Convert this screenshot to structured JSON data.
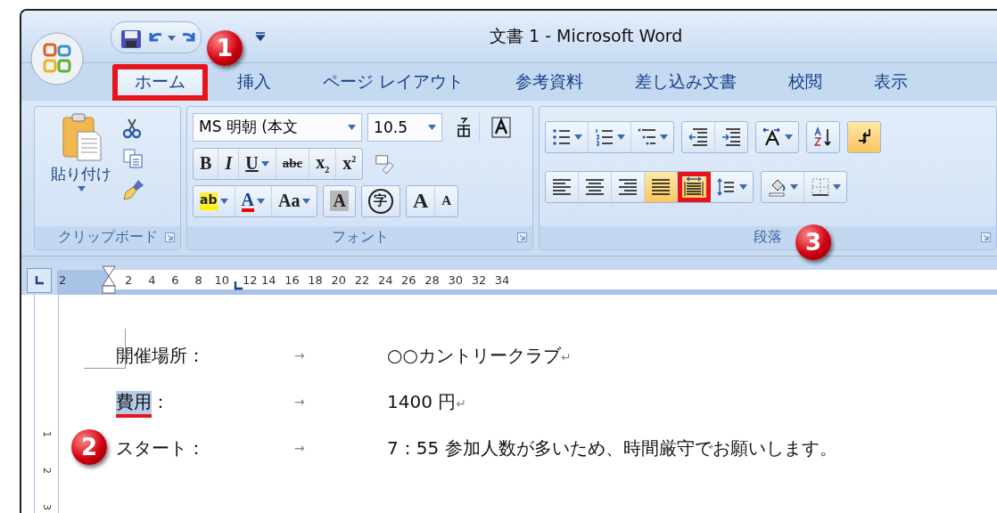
{
  "window": {
    "title": "文書 1 - Microsoft Word"
  },
  "tabs": [
    {
      "label": "ホーム",
      "selected": true,
      "boxed": true
    },
    {
      "label": "挿入",
      "selected": false,
      "boxed": false
    },
    {
      "label": "ページ レイアウト",
      "selected": false,
      "boxed": false
    },
    {
      "label": "参考資料",
      "selected": false,
      "boxed": false
    },
    {
      "label": "差し込み文書",
      "selected": false,
      "boxed": false
    },
    {
      "label": "校閲",
      "selected": false,
      "boxed": false
    },
    {
      "label": "表示",
      "selected": false,
      "boxed": false
    }
  ],
  "clipboard": {
    "paste_label": "貼り付け",
    "label": "クリップボード"
  },
  "font": {
    "font_name": "MS 明朝 (本文",
    "font_size": "10.5",
    "label": "フォント",
    "row2": [
      {
        "kind": "bold",
        "text": "B"
      },
      {
        "kind": "italic",
        "text": "I"
      },
      {
        "kind": "underline",
        "text": "U"
      },
      {
        "kind": "strike",
        "text": "abc"
      },
      {
        "kind": "sub",
        "text": "x",
        "mark": "2"
      },
      {
        "kind": "sup",
        "text": "x",
        "mark": "2"
      }
    ],
    "row3": [
      {
        "kind": "highlight",
        "text": "ab"
      },
      {
        "kind": "color",
        "text": "A"
      },
      {
        "kind": "case",
        "text": "Aa"
      },
      {
        "kind": "shade",
        "text": "A"
      },
      {
        "kind": "enclose",
        "text": "字"
      },
      {
        "kind": "grow",
        "text": "A"
      },
      {
        "kind": "shrink",
        "text": "A"
      }
    ]
  },
  "paragraph": {
    "label": "段落",
    "row1": [
      {
        "kind": "bullets",
        "selected": false
      },
      {
        "kind": "numbering",
        "selected": false
      },
      {
        "kind": "multilevel",
        "selected": false
      },
      {
        "kind": "outdent",
        "selected": false
      },
      {
        "kind": "indent",
        "selected": false
      },
      {
        "kind": "asian",
        "selected": false
      },
      {
        "kind": "sort",
        "selected": false
      },
      {
        "kind": "marks",
        "selected": true
      }
    ],
    "row2": [
      {
        "kind": "left",
        "selected": false,
        "boxed": false
      },
      {
        "kind": "center",
        "selected": false,
        "boxed": false
      },
      {
        "kind": "right",
        "selected": false,
        "boxed": false
      },
      {
        "kind": "justify",
        "selected": true,
        "boxed": false
      },
      {
        "kind": "distribute",
        "selected": true,
        "boxed": true
      },
      {
        "kind": "spacing",
        "selected": false,
        "boxed": false
      },
      {
        "kind": "shading",
        "selected": false,
        "boxed": false
      },
      {
        "kind": "borders",
        "selected": false,
        "boxed": false
      }
    ]
  },
  "ruler": {
    "left_number": "2",
    "numbers": [
      "2",
      "4",
      "6",
      "8",
      "10",
      "12",
      "14",
      "16",
      "18",
      "20",
      "22",
      "24",
      "26",
      "28",
      "30",
      "32",
      "34"
    ]
  },
  "vertical_ruler": [
    "1",
    "2",
    "3"
  ],
  "document": {
    "rows": [
      {
        "selection": "",
        "label": "開催場所：",
        "arrow": "→",
        "value": "○○カントリークラブ",
        "mark": "↵",
        "underlined": false
      },
      {
        "selection": "費用",
        "label": "：",
        "arrow": "→",
        "value": "1400 円",
        "mark": "↵",
        "underlined": true
      },
      {
        "selection": "",
        "label": "スタート：",
        "arrow": "→",
        "value": "7：55 参加人数が多いため、時間厳守でお願いします。",
        "mark": "",
        "underlined": false
      }
    ]
  },
  "callouts": [
    {
      "number": "1"
    },
    {
      "number": "2"
    },
    {
      "number": "3"
    }
  ]
}
